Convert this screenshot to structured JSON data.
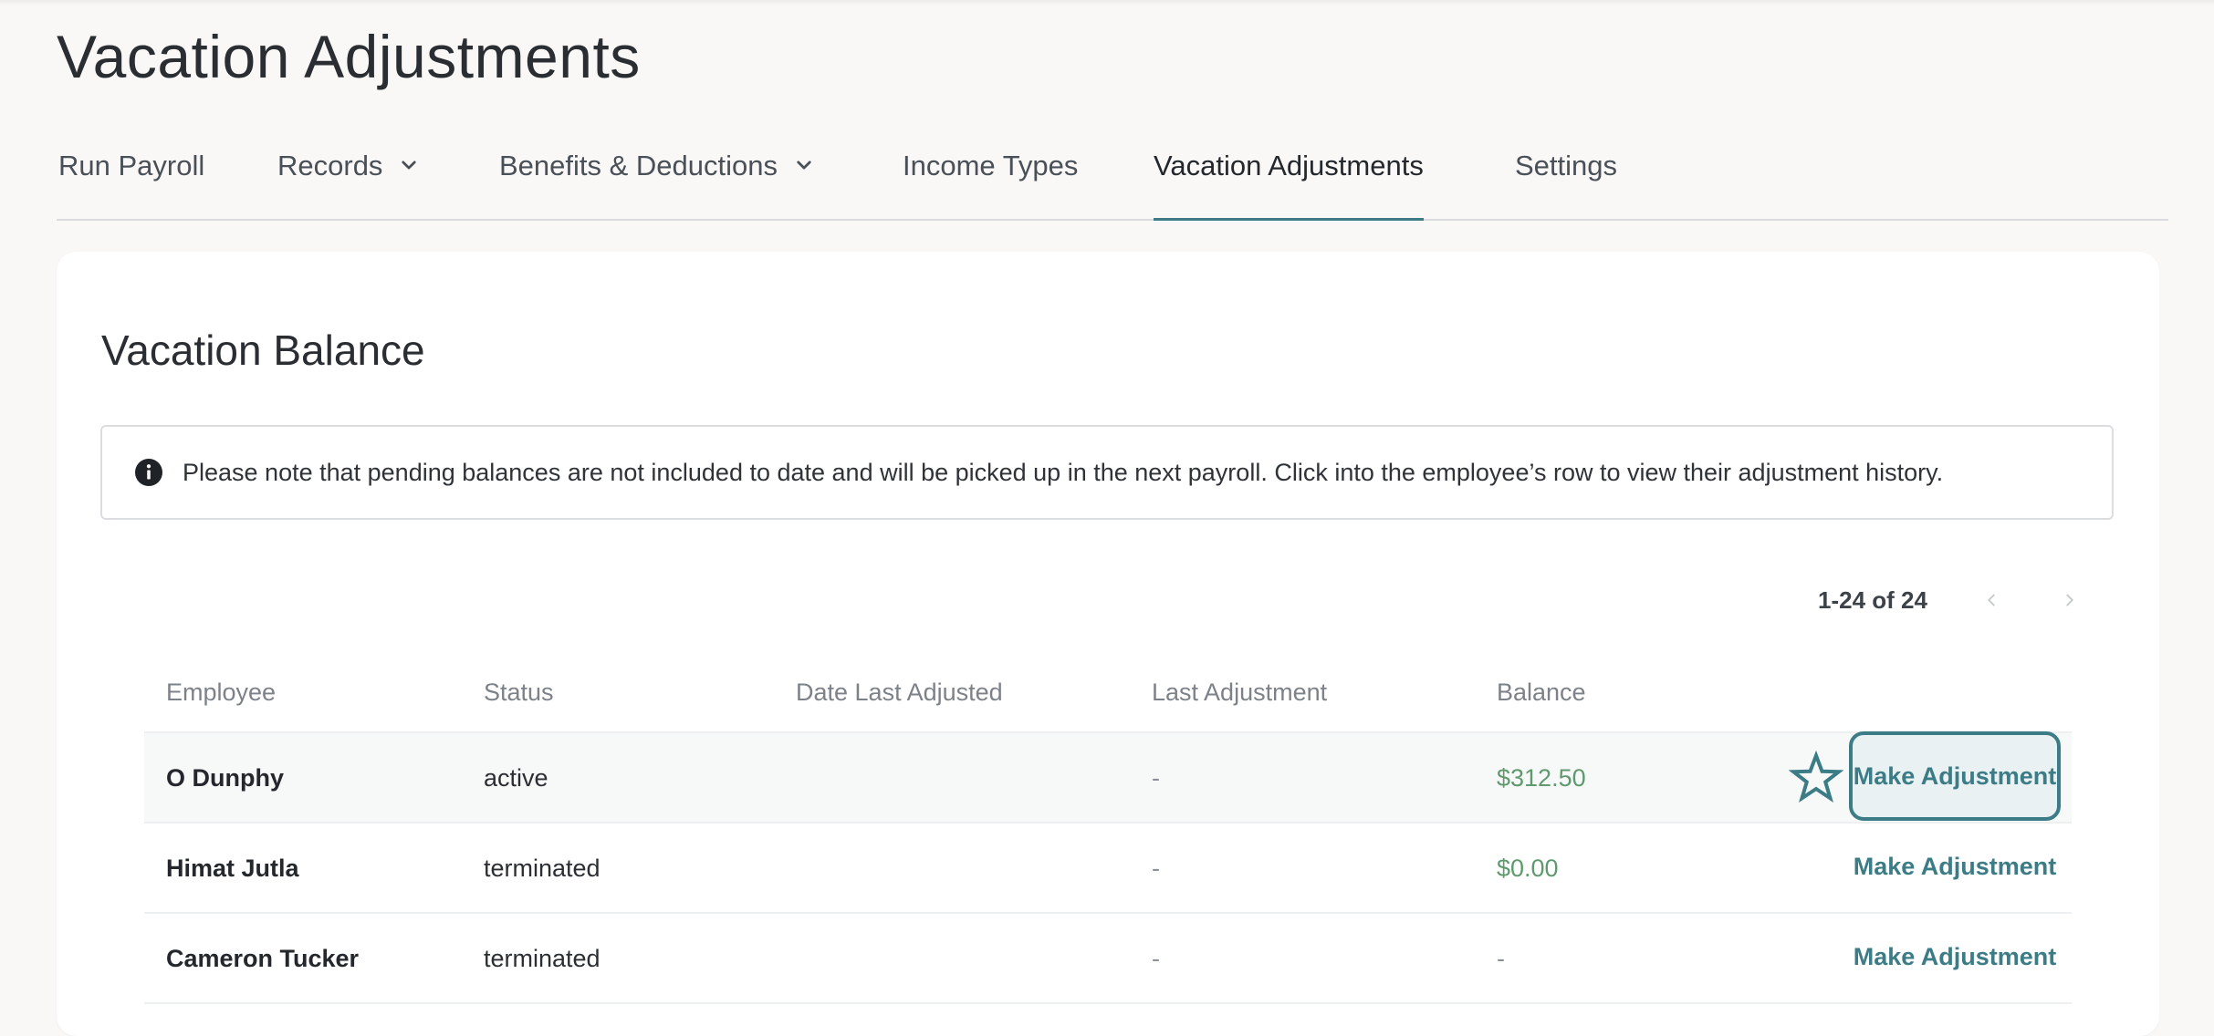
{
  "page": {
    "title": "Vacation Adjustments"
  },
  "tabs": [
    {
      "label": "Run Payroll",
      "has_dropdown": false,
      "active": false
    },
    {
      "label": "Records",
      "has_dropdown": true,
      "active": false
    },
    {
      "label": "Benefits & Deductions",
      "has_dropdown": true,
      "active": false
    },
    {
      "label": "Income Types",
      "has_dropdown": false,
      "active": false
    },
    {
      "label": "Vacation Adjustments",
      "has_dropdown": false,
      "active": true
    },
    {
      "label": "Settings",
      "has_dropdown": false,
      "active": false
    }
  ],
  "card": {
    "title": "Vacation Balance",
    "notice": "Please note that pending balances are not included to date and will be picked up in the next payroll. Click into the employee’s row to view their adjustment history.",
    "notice_icon": "info-icon"
  },
  "pager": {
    "text": "1-24 of 24",
    "prev_icon": "chevron-left-icon",
    "next_icon": "chevron-right-icon"
  },
  "table": {
    "headers": {
      "employee": "Employee",
      "status": "Status",
      "date_last_adjusted": "Date Last Adjusted",
      "last_adjustment": "Last Adjustment",
      "balance": "Balance"
    },
    "rows": [
      {
        "employee": "O Dunphy",
        "status": "active",
        "date_last_adjusted": "",
        "last_adjustment": "-",
        "balance": "$312.50",
        "action": "Make Adjustment"
      },
      {
        "employee": "Himat Jutla",
        "status": "terminated",
        "date_last_adjusted": "",
        "last_adjustment": "-",
        "balance": "$0.00",
        "action": "Make Adjustment"
      },
      {
        "employee": "Cameron Tucker",
        "status": "terminated",
        "date_last_adjusted": "",
        "last_adjustment": "-",
        "balance": "-",
        "action": "Make Adjustment"
      }
    ]
  },
  "colors": {
    "accent": "#3b7c86",
    "positive_balance": "#5e9a6e",
    "background": "#f9f8f7"
  }
}
